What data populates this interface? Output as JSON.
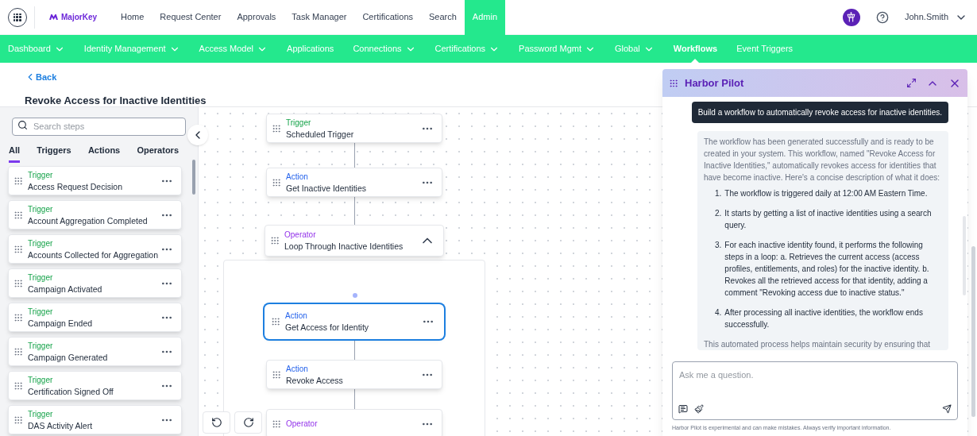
{
  "top_nav": {
    "brand": "MajorKey",
    "items": [
      {
        "label": "Home",
        "selected": false
      },
      {
        "label": "Request Center",
        "selected": false
      },
      {
        "label": "Approvals",
        "selected": false
      },
      {
        "label": "Task Manager",
        "selected": false
      },
      {
        "label": "Certifications",
        "selected": false
      },
      {
        "label": "Search",
        "selected": false
      },
      {
        "label": "Admin",
        "selected": true
      }
    ],
    "user": "John.Smith"
  },
  "sub_nav": [
    {
      "label": "Dashboard",
      "has_menu": true,
      "selected": false
    },
    {
      "label": "Identity Management",
      "has_menu": true,
      "selected": false
    },
    {
      "label": "Access Model",
      "has_menu": true,
      "selected": false
    },
    {
      "label": "Applications",
      "has_menu": false,
      "selected": false
    },
    {
      "label": "Connections",
      "has_menu": true,
      "selected": false
    },
    {
      "label": "Certifications",
      "has_menu": true,
      "selected": false
    },
    {
      "label": "Password Mgmt",
      "has_menu": true,
      "selected": false
    },
    {
      "label": "Global",
      "has_menu": true,
      "selected": false
    },
    {
      "label": "Workflows",
      "has_menu": false,
      "selected": true
    },
    {
      "label": "Event Triggers",
      "has_menu": false,
      "selected": false
    }
  ],
  "back": "Back",
  "title": "Revoke Access for Inactive Identities",
  "steps_panel": {
    "search": {
      "placeholder": "Search steps"
    },
    "tabs": [
      {
        "label": "All",
        "selected": true
      },
      {
        "label": "Triggers",
        "selected": false
      },
      {
        "label": "Actions",
        "selected": false
      },
      {
        "label": "Operators",
        "selected": false
      }
    ],
    "steps": [
      {
        "kind": "trigger",
        "category": "Trigger",
        "name": "Access Request Decision"
      },
      {
        "kind": "trigger",
        "category": "Trigger",
        "name": "Account Aggregation Completed"
      },
      {
        "kind": "trigger",
        "category": "Trigger",
        "name": "Accounts Collected for Aggregation"
      },
      {
        "kind": "trigger",
        "category": "Trigger",
        "name": "Campaign Activated"
      },
      {
        "kind": "trigger",
        "category": "Trigger",
        "name": "Campaign Ended"
      },
      {
        "kind": "trigger",
        "category": "Trigger",
        "name": "Campaign Generated"
      },
      {
        "kind": "trigger",
        "category": "Trigger",
        "name": "Certification Signed Off"
      },
      {
        "kind": "trigger",
        "category": "Trigger",
        "name": "DAS Activity Alert"
      }
    ]
  },
  "canvas": {
    "nodes": [
      {
        "kind": "trigger",
        "category": "Trigger",
        "name": "Scheduled Trigger",
        "selected": false
      },
      {
        "kind": "action",
        "category": "Action",
        "name": "Get Inactive Identities",
        "selected": false
      },
      {
        "kind": "operator",
        "category": "Operator",
        "name": "Loop Through Inactive Identities",
        "selected": false,
        "expanded": true
      }
    ],
    "loop_nodes": [
      {
        "kind": "action",
        "category": "Action",
        "name": "Get Access for Identity",
        "selected": true
      },
      {
        "kind": "action",
        "category": "Action",
        "name": "Revoke Access",
        "selected": false
      },
      {
        "kind": "operator",
        "category": "Operator",
        "selected": false
      }
    ]
  },
  "chat": {
    "title": "Harbor Pilot",
    "user_message": "Build a workflow to automatically revoke access for inactive identities.",
    "reply_intro": "The workflow has been generated successfully and is ready to be created in your system. This workflow, named \"Revoke Access for Inactive Identities,\" automatically revokes access for identities that have become inactive. Here's a concise description of what it does:",
    "reply_steps": [
      {
        "number": "1.",
        "text": "The workflow is triggered daily at 12:00 AM Eastern Time."
      },
      {
        "number": "2.",
        "text": "It starts by getting a list of inactive identities using a search query."
      },
      {
        "number": "3.",
        "text": "For each inactive identity found, it performs the following steps in a loop: a. Retrieves the current access (access profiles, entitlements, and roles) for the inactive identity. b. Revokes all the retrieved access for that identity, adding a comment \"Revoking access due to inactive status.\""
      },
      {
        "number": "4.",
        "text": "After processing all inactive identities, the workflow ends successfully."
      }
    ],
    "reply_outro": "This automated process helps maintain security by ensuring that",
    "input": {
      "placeholder": "Ask me a question."
    },
    "disclaimer": "Harbor Pilot is experimental and can make mistakes. Always verify important information."
  }
}
